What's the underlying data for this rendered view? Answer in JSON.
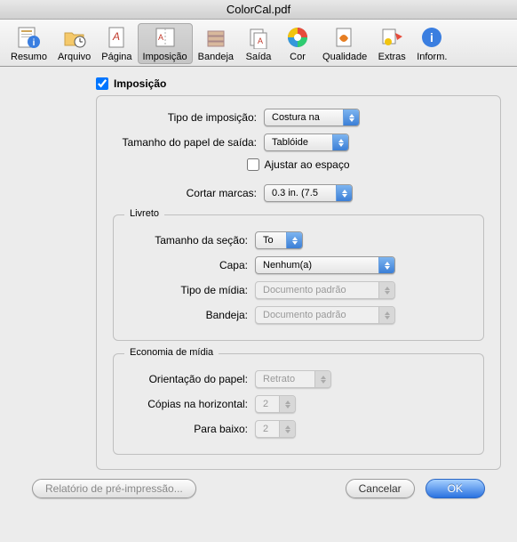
{
  "window": {
    "title": "ColorCal.pdf"
  },
  "toolbar": {
    "items": [
      {
        "label": "Resumo"
      },
      {
        "label": "Arquivo"
      },
      {
        "label": "Página"
      },
      {
        "label": "Imposição"
      },
      {
        "label": "Bandeja"
      },
      {
        "label": "Saída"
      },
      {
        "label": "Cor"
      },
      {
        "label": "Qualidade"
      },
      {
        "label": "Extras"
      },
      {
        "label": "Inform."
      }
    ]
  },
  "form": {
    "enable_label": "Imposição",
    "enable_checked": true,
    "type_label": "Tipo de imposição:",
    "type_value": "Costura na",
    "paper_size_label": "Tamanho do papel de saída:",
    "paper_size_value": "Tablóide",
    "fit_to_space_label": "Ajustar ao espaço",
    "fit_to_space_checked": false,
    "crop_label": "Cortar marcas:",
    "crop_value": "0.3 in. (7.5",
    "booklet": {
      "legend": "Livreto",
      "section_label": "Tamanho da seção:",
      "section_value": "To",
      "cover_label": "Capa:",
      "cover_value": "Nenhum(a)",
      "media_type_label": "Tipo de mídia:",
      "media_type_value": "Documento padrão",
      "tray_label": "Bandeja:",
      "tray_value": "Documento padrão"
    },
    "economy": {
      "legend": "Economia de mídia",
      "orientation_label": "Orientação do papel:",
      "orientation_value": "Retrato",
      "copies_h_label": "Cópias na horizontal:",
      "copies_h_value": "2",
      "copies_v_label": "Para baixo:",
      "copies_v_value": "2"
    }
  },
  "footer": {
    "report_label": "Relatório de pré-impressão...",
    "cancel_label": "Cancelar",
    "ok_label": "OK"
  }
}
